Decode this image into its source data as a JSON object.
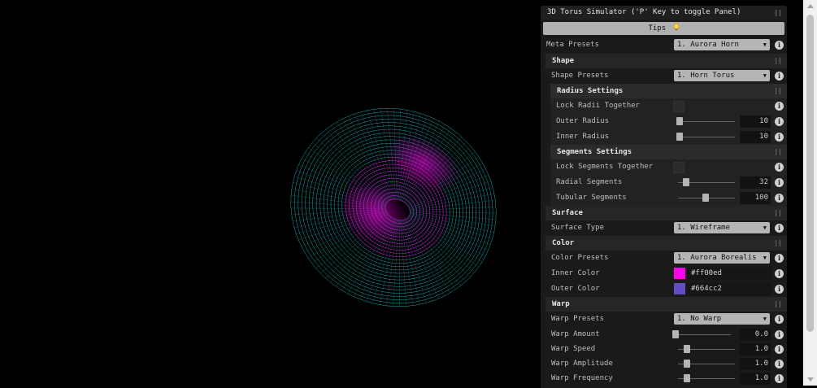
{
  "panel": {
    "title": "3D Torus Simulator ('P' Key to toggle Panel)",
    "tips_label": "Tips",
    "meta_presets_label": "Meta Presets",
    "meta_presets_value": "1. Aurora Horn"
  },
  "shape": {
    "title": "Shape",
    "presets_label": "Shape Presets",
    "presets_value": "1. Horn Torus",
    "radius": {
      "title": "Radius Settings",
      "lock_label": "Lock Radii Together",
      "outer_label": "Outer Radius",
      "outer_value": "10",
      "inner_label": "Inner Radius",
      "inner_value": "10"
    },
    "segments": {
      "title": "Segments Settings",
      "lock_label": "Lock Segments Together",
      "radial_label": "Radial Segments",
      "radial_value": "32",
      "tubular_label": "Tubular Segments",
      "tubular_value": "100"
    }
  },
  "surface": {
    "title": "Surface",
    "type_label": "Surface Type",
    "type_value": "1. Wireframe"
  },
  "color": {
    "title": "Color",
    "presets_label": "Color Presets",
    "presets_value": "1. Aurora Borealis",
    "inner_label": "Inner Color",
    "inner_value": "#ff00ed",
    "outer_label": "Outer Color",
    "outer_value": "#664cc2"
  },
  "warp": {
    "title": "Warp",
    "presets_label": "Warp Presets",
    "presets_value": "1. No Warp",
    "amount_label": "Warp Amount",
    "amount_value": "0.0",
    "speed_label": "Warp Speed",
    "speed_value": "1.0",
    "amplitude_label": "Warp Amplitude",
    "amplitude_value": "1.0",
    "frequency_label": "Warp Frequency",
    "frequency_value": "1.0"
  },
  "colors": {
    "inner_swatch": "#ff00ed",
    "outer_swatch": "#664cc2",
    "wire_outer": "#1fc4c9",
    "wire_inner": "#e312e6"
  },
  "icons": {
    "info": "i",
    "collapse": "||",
    "caret": "▼"
  }
}
